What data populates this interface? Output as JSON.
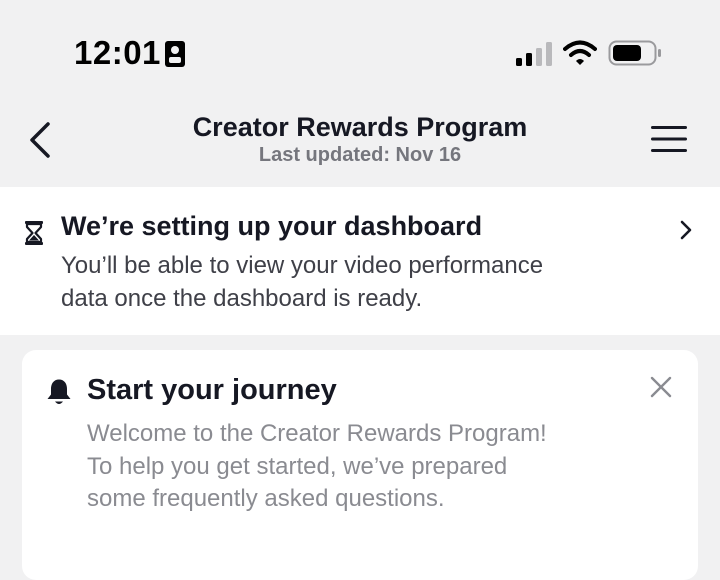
{
  "status_bar": {
    "time": "12:01",
    "icons": [
      "id-card-icon",
      "cellular-signal-icon",
      "wifi-icon",
      "battery-icon"
    ]
  },
  "header": {
    "title": "Creator Rewards Program",
    "subtitle": "Last updated: Nov 16",
    "back_icon": "chevron-left-icon",
    "menu_icon": "hamburger-menu-icon"
  },
  "notice": {
    "icon": "hourglass-icon",
    "title": "We’re setting up your dashboard",
    "body": "You’ll be able to view your video performance\ndata once the dashboard is ready.",
    "action_icon": "chevron-right-icon"
  },
  "journey_card": {
    "icon": "bell-icon",
    "title": "Start your journey",
    "body": "Welcome to the Creator Rewards Program!\nTo help you get started, we’ve prepared\nsome frequently asked questions.",
    "dismiss_icon": "close-icon"
  },
  "colors": {
    "page_background": "#f1f1f2",
    "surface": "#ffffff",
    "primary_text": "#161823",
    "secondary_text": "#75767d",
    "muted_text": "#8a8b91"
  }
}
